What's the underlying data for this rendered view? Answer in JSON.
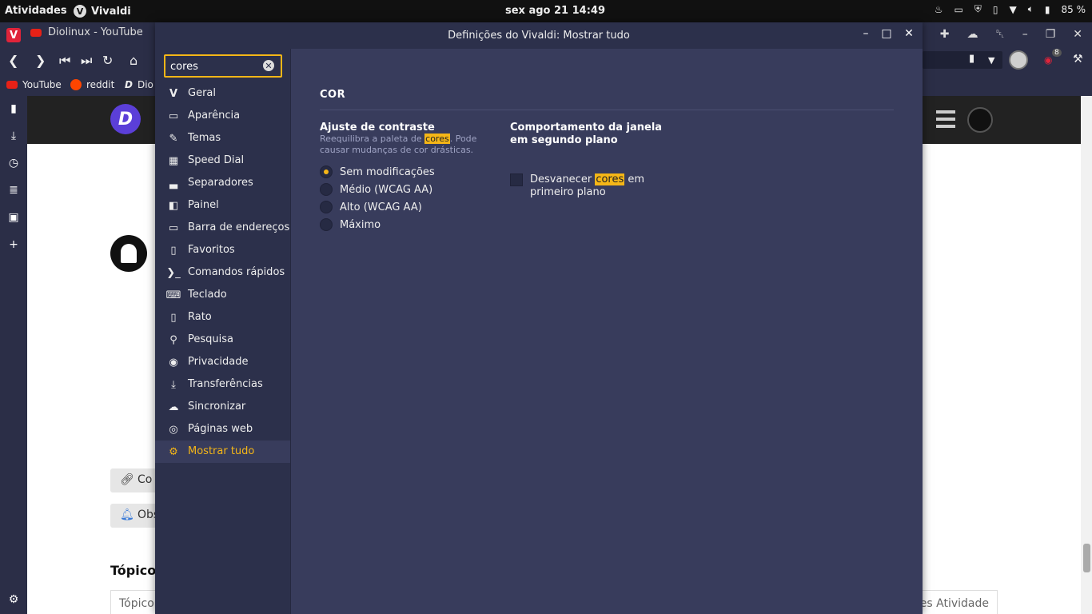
{
  "topbar": {
    "activities": "Atividades",
    "app_name": "Vivaldi",
    "app_icon_letter": "V",
    "clock": "sex ago 21  14:49",
    "battery": "85 %",
    "tray_icons": [
      "flame-icon",
      "drive-icon",
      "shield-icon",
      "phone-icon",
      "wifi-icon",
      "volume-icon",
      "battery-icon"
    ]
  },
  "browser": {
    "tab_title": "Diolinux - YouTube",
    "extension_badge": "8",
    "bookmarks": [
      "YouTube",
      "reddit",
      "Dio"
    ]
  },
  "webpage": {
    "pill1": "Co",
    "pill2": "Obs",
    "topics_heading": "Tópicos",
    "table_left": "Tópico",
    "table_right": "es  Atividade"
  },
  "settings": {
    "window_title": "Definições do Vivaldi: Mostrar tudo",
    "search_value": "cores",
    "categories": [
      {
        "label": "Geral",
        "icon": "vivaldi-icon"
      },
      {
        "label": "Aparência",
        "icon": "folder-icon"
      },
      {
        "label": "Temas",
        "icon": "brush-icon"
      },
      {
        "label": "Speed Dial",
        "icon": "grid-icon"
      },
      {
        "label": "Separadores",
        "icon": "tabs-icon"
      },
      {
        "label": "Painel",
        "icon": "panel-icon"
      },
      {
        "label": "Barra de endereços",
        "icon": "address-bar-icon"
      },
      {
        "label": "Favoritos",
        "icon": "bookmark-icon"
      },
      {
        "label": "Comandos rápidos",
        "icon": "command-icon"
      },
      {
        "label": "Teclado",
        "icon": "keyboard-icon"
      },
      {
        "label": "Rato",
        "icon": "mouse-icon"
      },
      {
        "label": "Pesquisa",
        "icon": "search-icon"
      },
      {
        "label": "Privacidade",
        "icon": "eye-icon"
      },
      {
        "label": "Transferências",
        "icon": "download-icon"
      },
      {
        "label": "Sincronizar",
        "icon": "cloud-icon"
      },
      {
        "label": "Páginas web",
        "icon": "globe-icon"
      },
      {
        "label": "Mostrar tudo",
        "icon": "gear-icon",
        "active": true
      }
    ],
    "section_title": "COR",
    "contrast": {
      "title": "Ajuste de contraste",
      "desc_before": "Reequilibra a paleta de ",
      "desc_highlight": "cores",
      "desc_after": ". Pode causar mudanças de cor drásticas.",
      "options": [
        "Sem modificações",
        "Médio (WCAG AA)",
        "Alto (WCAG AA)",
        "Máximo"
      ],
      "selected": 0
    },
    "background": {
      "title": "Comportamento da janela em segundo plano",
      "check_before": "Desvanecer ",
      "check_highlight": "cores",
      "check_after": " em primeiro plano",
      "checked": false
    },
    "accent_color": "#f5b617"
  }
}
